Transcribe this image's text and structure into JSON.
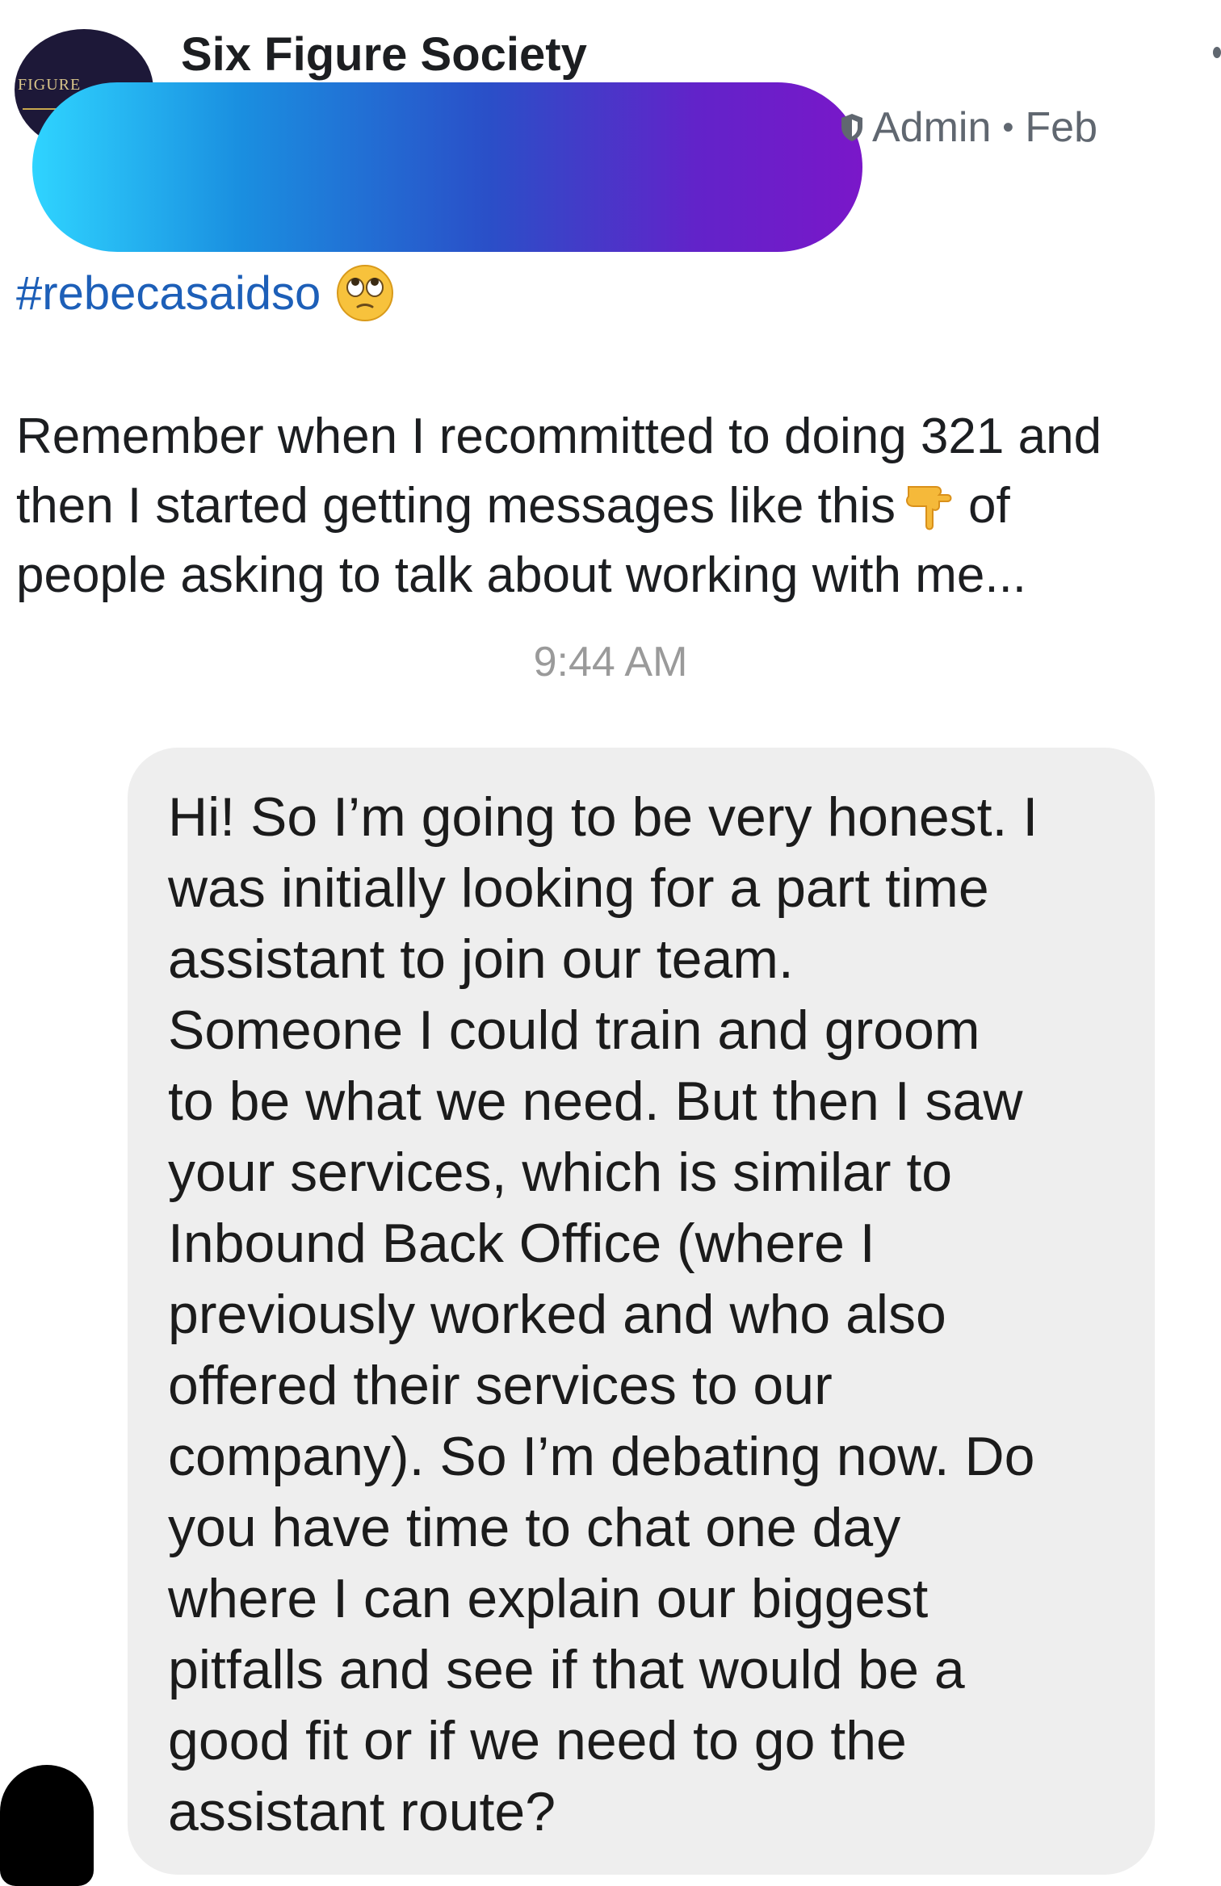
{
  "post": {
    "group_name": "Six Figure Society",
    "avatar_text": "FIGURE",
    "role": "Admin",
    "date": "Feb",
    "hashtag": "#rebecasaidso",
    "body_lines": [
      "Remember when I recommitted to doing 321 and",
      "then I started getting messages like this",
      "of",
      "people asking to talk about working with me..."
    ]
  },
  "screenshot": {
    "timestamp": "9:44 AM",
    "message_lines": [
      "Hi! So I’m going to be very honest. I",
      "was initially looking for a part time",
      "assistant to join our team.",
      "Someone I could train and groom",
      "to be what we need. But then I saw",
      "your services, which is similar to",
      "Inbound Back Office (where I",
      "previously worked and who also",
      "offered their services to our",
      "company). So I’m debating now. Do",
      "you have time to chat one day",
      "where I can explain our biggest",
      "pitfalls and see if that would be a",
      "good fit or if we need to go the",
      "assistant route?"
    ]
  },
  "icons": {
    "shield": "admin-shield-icon",
    "emoji_eyeroll": "face-with-rolling-eyes-icon",
    "emoji_point": "backhand-index-pointing-down-icon",
    "more": "more-options-icon"
  },
  "colors": {
    "hashtag": "#1d5fb8",
    "meta_text": "#606770",
    "bubble_bg": "#eeeeee",
    "timestamp": "#9a9a9a"
  }
}
